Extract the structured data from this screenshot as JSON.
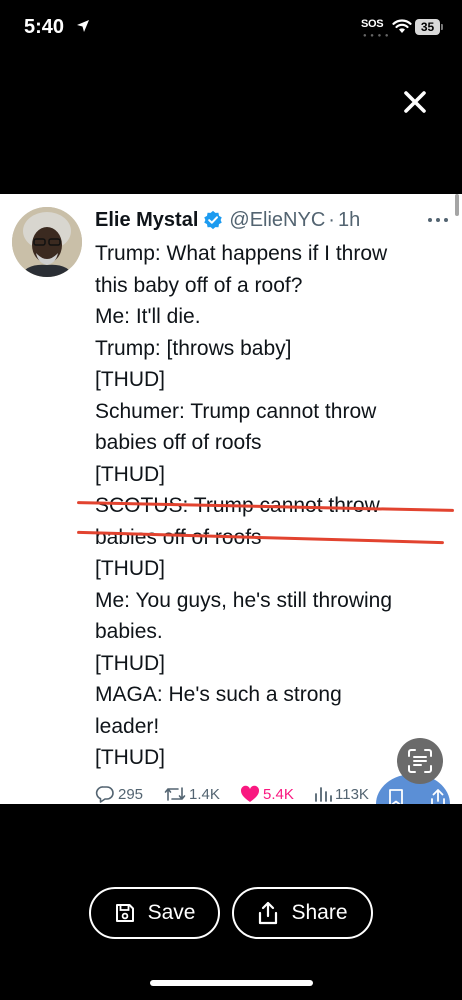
{
  "status_bar": {
    "time": "5:40",
    "sos": "SOS",
    "battery": "35",
    "icons": [
      "location-arrow-icon",
      "wifi-icon",
      "battery-icon"
    ]
  },
  "viewer": {
    "close_icon": "close-icon"
  },
  "tweet": {
    "author_name": "Elie Mystal",
    "handle": "@ElieNYC",
    "separator": "·",
    "age": "1h",
    "verified": true,
    "lines": [
      {
        "text": "Trump: What happens if I throw",
        "struck": false
      },
      {
        "text": "this baby off of a roof?",
        "struck": false
      },
      {
        "text": "Me: It'll die.",
        "struck": false
      },
      {
        "text": "Trump: [throws baby]",
        "struck": false
      },
      {
        "text": "[THUD]",
        "struck": false
      },
      {
        "text": "Schumer: Trump cannot throw",
        "struck": false
      },
      {
        "text": "babies off of roofs",
        "struck": false
      },
      {
        "text": "[THUD]",
        "struck": false
      },
      {
        "text": "SCOTUS: Trump cannot throw",
        "struck": true
      },
      {
        "text": "babies off of roofs",
        "struck": true
      },
      {
        "text": "[THUD]",
        "struck": false
      },
      {
        "text": "Me: You guys, he's still throwing",
        "struck": false
      },
      {
        "text": "babies.",
        "struck": false
      },
      {
        "text": "[THUD]",
        "struck": false
      },
      {
        "text": "MAGA: He's such a strong",
        "struck": false
      },
      {
        "text": "leader!",
        "struck": false
      },
      {
        "text": "[THUD]",
        "struck": false
      }
    ],
    "strike_color": "#e2432f",
    "stats": {
      "replies": "295",
      "reposts": "1.4K",
      "likes": "5.4K",
      "views": "113K"
    },
    "like_color": "#f91880"
  },
  "bottom_bar": {
    "save_label": "Save",
    "share_label": "Share"
  }
}
